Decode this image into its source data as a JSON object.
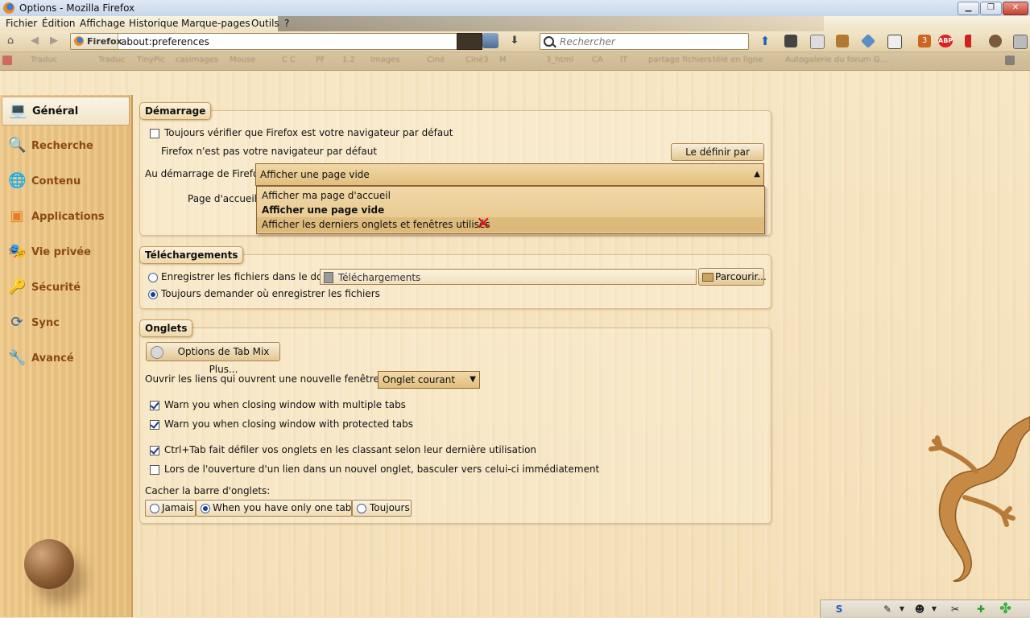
{
  "window": {
    "title": "Options - Mozilla Firefox"
  },
  "menu": [
    "Fichier",
    "Édition",
    "Affichage",
    "Historique",
    "Marque-pages",
    "Outils",
    "?"
  ],
  "nav": {
    "identity_label": "Firefox",
    "url": "about:preferences",
    "search_placeholder": "Rechercher",
    "abp_label": "ABP",
    "badge_count": "3"
  },
  "bookmarks": [
    "Traduc",
    "Traduc",
    "TinyPic",
    "casimages",
    "Mouse",
    "C C",
    "PF",
    "1.2",
    "Images",
    "Ciné",
    "Ciné3",
    "M",
    "3_html",
    "CA",
    "IT",
    "partage fichiers",
    "télé en ligne",
    "Autogalerie du forum G..."
  ],
  "sidebar": {
    "categories": [
      {
        "label": "Général",
        "icon": "general-icon"
      },
      {
        "label": "Recherche",
        "icon": "search-icon"
      },
      {
        "label": "Contenu",
        "icon": "content-icon"
      },
      {
        "label": "Applications",
        "icon": "applications-icon"
      },
      {
        "label": "Vie privée",
        "icon": "privacy-icon"
      },
      {
        "label": "Sécurité",
        "icon": "security-icon"
      },
      {
        "label": "Sync",
        "icon": "sync-icon"
      },
      {
        "label": "Avancé",
        "icon": "advanced-icon"
      }
    ],
    "selected": "Général"
  },
  "startup": {
    "caption": "Démarrage",
    "check_default_label": "Toujours vérifier que Firefox est votre navigateur par défaut",
    "check_default_checked": false,
    "not_default_text": "Firefox n'est pas votre navigateur par défaut",
    "set_default_button": "Le définir par défaut",
    "on_start_label": "Au démarrage de Firefox :",
    "on_start_value": "Afficher une page vide",
    "on_start_options": [
      "Afficher ma page d'accueil",
      "Afficher une page vide",
      "Afficher les derniers onglets et fenêtres utilisés"
    ],
    "homepage_label": "Page d'accueil :"
  },
  "downloads": {
    "caption": "Téléchargements",
    "save_to_label": "Enregistrer les fichiers dans le dossier",
    "folder_value": "Téléchargements",
    "browse_button": "Parcourir...",
    "always_ask_label": "Toujours demander où enregistrer les fichiers",
    "selected_option": "always_ask"
  },
  "tabs": {
    "caption": "Onglets",
    "tmp_button": "Options de Tab Mix Plus...",
    "open_links_label": "Ouvrir les liens qui ouvrent une nouvelle fenêtre dans :",
    "open_links_value": "Onglet courant",
    "warn_multiple": "Warn you when closing window with multiple tabs",
    "warn_multiple_checked": true,
    "warn_protected": "Warn you when closing window with protected tabs",
    "warn_protected_checked": true,
    "ctrl_tab": "Ctrl+Tab fait défiler vos onglets en les classant selon leur dernière utilisation",
    "ctrl_tab_checked": true,
    "switch_new_tab": "Lors de l'ouverture d'un lien dans un nouvel onglet, basculer vers celui-ci immédiatement",
    "switch_new_tab_checked": false,
    "hide_tabbar_label": "Cacher la barre d'onglets:",
    "hide_options": [
      "Jamais",
      "When you have only one tab (S)",
      "Toujours"
    ],
    "hide_selected": "When you have only one tab (S)"
  },
  "colors": {
    "sidebar_text": "#8a4b14",
    "accent_radio": "#1c3f8c",
    "close_button": "#c4402c",
    "annotation_x": "#e01010"
  }
}
